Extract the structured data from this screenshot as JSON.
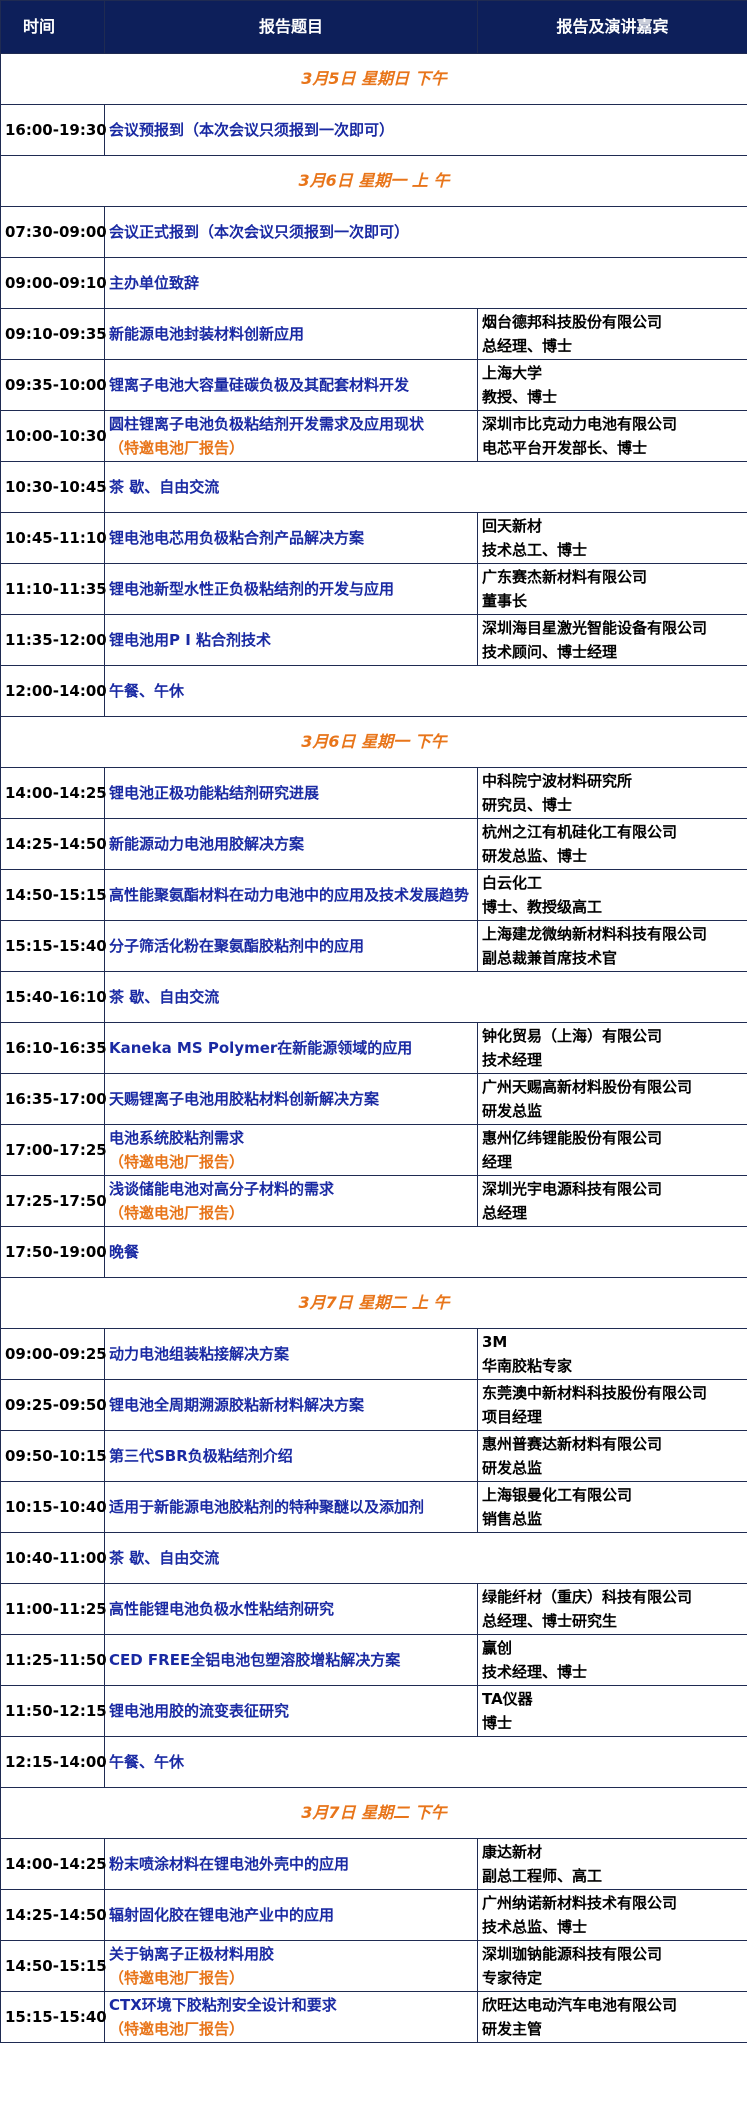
{
  "headers": {
    "time": "时间",
    "topic": "报告题目",
    "speaker": "报告及演讲嘉宾"
  },
  "rows": [
    {
      "type": "section",
      "text": "3月5日  星期日  下午"
    },
    {
      "type": "row",
      "time": "16:00-19:30",
      "topic": "会议预报到（本次会议只须报到一次即可）",
      "span": true
    },
    {
      "type": "section",
      "text": "3月6日  星期一 上 午"
    },
    {
      "type": "row",
      "time": "07:30-09:00",
      "topic": "会议正式报到（本次会议只须报到一次即可）",
      "span": true
    },
    {
      "type": "row",
      "time": "09:00-09:10",
      "topic": "主办单位致辞",
      "span": true
    },
    {
      "type": "row",
      "time": "09:10-09:35",
      "topic": "新能源电池封装材料创新应用",
      "org": "烟台德邦科技股份有限公司",
      "role": "总经理、博士"
    },
    {
      "type": "row",
      "time": "09:35-10:00",
      "topic": "锂离子电池大容量硅碳负极及其配套材料开发",
      "org": "上海大学",
      "role": "教授、博士"
    },
    {
      "type": "row",
      "time": "10:00-10:30",
      "topic": "圆柱锂离子电池负极粘结剂开发需求及应用现状",
      "note": "（特邀电池厂报告）",
      "org": "深圳市比克动力电池有限公司",
      "role": "电芯平台开发部长、博士"
    },
    {
      "type": "row",
      "time": "10:30-10:45",
      "topic": "茶 歇、自由交流",
      "span": true
    },
    {
      "type": "row",
      "time": "10:45-11:10",
      "topic": "锂电池电芯用负极粘合剂产品解决方案",
      "org": "回天新材",
      "role": "技术总工、博士"
    },
    {
      "type": "row",
      "time": "11:10-11:35",
      "topic": "锂电池新型水性正负极粘结剂的开发与应用",
      "org": "广东赛杰新材料有限公司",
      "role": "董事长"
    },
    {
      "type": "row",
      "time": "11:35-12:00",
      "topic": "锂电池用P I 粘合剂技术",
      "org": "深圳海目星激光智能设备有限公司",
      "role": "技术顾问、博士经理"
    },
    {
      "type": "row",
      "time": "12:00-14:00",
      "topic": "午餐、午休",
      "span": true
    },
    {
      "type": "section",
      "text": "3月6日  星期一  下午"
    },
    {
      "type": "row",
      "time": "14:00-14:25",
      "topic": "锂电池正极功能粘结剂研究进展",
      "org": "中科院宁波材料研究所",
      "role": "研究员、博士"
    },
    {
      "type": "row",
      "time": "14:25-14:50",
      "topic": "新能源动力电池用胶解决方案",
      "org": "杭州之江有机硅化工有限公司",
      "role": "研发总监、博士"
    },
    {
      "type": "row",
      "time": "14:50-15:15",
      "topic": "高性能聚氨酯材料在动力电池中的应用及技术发展趋势",
      "org": "白云化工",
      "role": "博士、教授级高工"
    },
    {
      "type": "row",
      "time": "15:15-15:40",
      "topic": "分子筛活化粉在聚氨酯胶粘剂中的应用",
      "org": "上海建龙微纳新材料科技有限公司",
      "role": "副总裁兼首席技术官"
    },
    {
      "type": "row",
      "time": "15:40-16:10",
      "topic": "茶 歇、自由交流",
      "span": true
    },
    {
      "type": "row",
      "time": "16:10-16:35",
      "topic": "Kaneka MS Polymer在新能源领域的应用",
      "org": "钟化贸易（上海）有限公司",
      "role": "技术经理"
    },
    {
      "type": "row",
      "time": "16:35-17:00",
      "topic": "天赐锂离子电池用胶粘材料创新解决方案",
      "org": "广州天赐高新材料股份有限公司",
      "role": "研发总监"
    },
    {
      "type": "row",
      "time": "17:00-17:25",
      "topic": "电池系统胶粘剂需求",
      "note": "（特邀电池厂报告）",
      "org": "惠州亿纬锂能股份有限公司",
      "role": "经理"
    },
    {
      "type": "row",
      "time": "17:25-17:50",
      "topic": "浅谈储能电池对高分子材料的需求",
      "note": "（特邀电池厂报告）",
      "org": "深圳光宇电源科技有限公司",
      "role": "总经理"
    },
    {
      "type": "row",
      "time": "17:50-19:00",
      "topic": "晚餐",
      "span": true
    },
    {
      "type": "section",
      "text": "3月7日  星期二 上 午"
    },
    {
      "type": "row",
      "time": "09:00-09:25",
      "topic": "动力电池组装粘接解决方案",
      "org": "3M",
      "role": "华南胶粘专家"
    },
    {
      "type": "row",
      "time": "09:25-09:50",
      "topic": "锂电池全周期溯源胶粘新材料解决方案",
      "org": "东莞澳中新材料科技股份有限公司",
      "role": "项目经理"
    },
    {
      "type": "row",
      "time": "09:50-10:15",
      "topic": "第三代SBR负极粘结剂介绍",
      "org": "惠州普赛达新材料有限公司",
      "role": "研发总监"
    },
    {
      "type": "row",
      "time": "10:15-10:40",
      "topic": "适用于新能源电池胶粘剂的特种聚醚以及添加剂",
      "org": "上海银曼化工有限公司",
      "role": "销售总监"
    },
    {
      "type": "row",
      "time": "10:40-11:00",
      "topic": "茶 歇、自由交流",
      "span": true
    },
    {
      "type": "row",
      "time": "11:00-11:25",
      "topic": "高性能锂电池负极水性粘结剂研究",
      "org": "绿能纤材（重庆）科技有限公司",
      "role": "总经理、博士研究生"
    },
    {
      "type": "row",
      "time": "11:25-11:50",
      "topic": "CED FREE全铝电池包塑溶胶增粘解决方案",
      "org": "赢创",
      "role": "技术经理、博士"
    },
    {
      "type": "row",
      "time": "11:50-12:15",
      "topic": "锂电池用胶的流变表征研究",
      "org": "TA仪器",
      "role": "博士"
    },
    {
      "type": "row",
      "time": "12:15-14:00",
      "topic": "午餐、午休",
      "span": true
    },
    {
      "type": "section",
      "text": "3月7日  星期二  下午"
    },
    {
      "type": "row",
      "time": "14:00-14:25",
      "topic": "粉末喷涂材料在锂电池外壳中的应用",
      "org": "康达新材",
      "role": "副总工程师、高工"
    },
    {
      "type": "row",
      "time": "14:25-14:50",
      "topic": "辐射固化胶在锂电池产业中的应用",
      "org": "广州纳诺新材料技术有限公司",
      "role": "技术总监、博士"
    },
    {
      "type": "row",
      "time": "14:50-15:15",
      "topic": "关于钠离子正极材料用胶",
      "note": "（特邀电池厂报告）",
      "org": "深圳珈钠能源科技有限公司",
      "role": "专家待定"
    },
    {
      "type": "row",
      "time": "15:15-15:40",
      "topic": "CTX环境下胶粘剂安全设计和要求",
      "note": "（特邀电池厂报告）",
      "org": "欣旺达电动汽车电池有限公司",
      "role": "研发主管"
    }
  ]
}
